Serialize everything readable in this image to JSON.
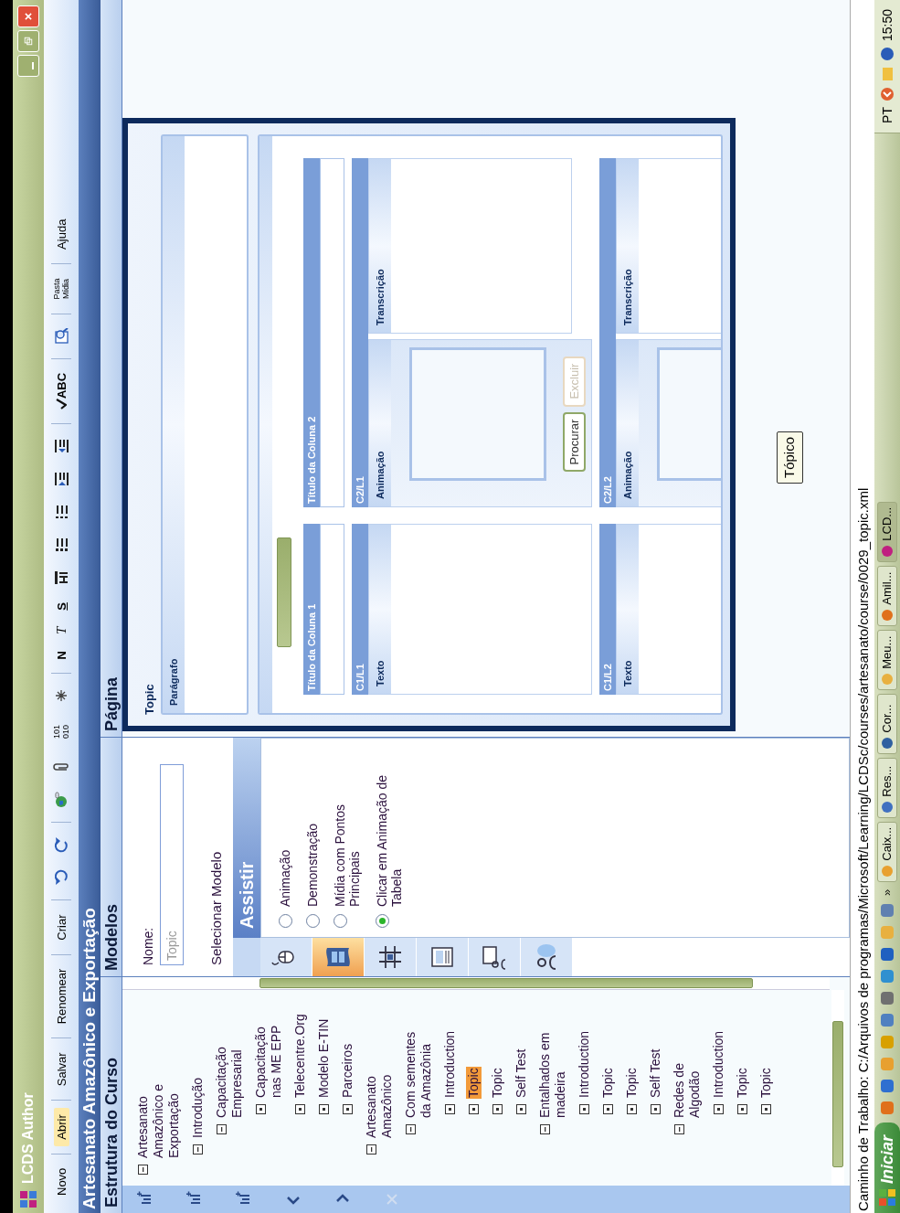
{
  "window": {
    "title": "LCDS Author"
  },
  "toolbar": [
    {
      "kind": "text",
      "label": "Novo",
      "highlighted": false,
      "sep": true
    },
    {
      "kind": "text",
      "label": "Abrir",
      "highlighted": true,
      "sep": true
    },
    {
      "kind": "text",
      "label": "Salvar",
      "highlighted": false,
      "sep": true
    },
    {
      "kind": "text",
      "label": "Renomear",
      "highlighted": false,
      "sep": true
    },
    {
      "kind": "text",
      "label": "Criar",
      "highlighted": false,
      "sep": true
    },
    {
      "kind": "undo",
      "highlighted": false,
      "sep": false
    },
    {
      "kind": "redo",
      "highlighted": false,
      "sep": true
    },
    {
      "kind": "globe",
      "highlighted": false,
      "sep": false
    },
    {
      "kind": "clip",
      "highlighted": false,
      "sep": false
    },
    {
      "kind": "small",
      "label": "101 010",
      "highlighted": false,
      "sep": false
    },
    {
      "kind": "asterisk",
      "highlighted": false,
      "sep": true
    },
    {
      "kind": "bold",
      "label": "N",
      "highlighted": false,
      "sep": false
    },
    {
      "kind": "italic",
      "label": "T",
      "highlighted": false,
      "sep": false
    },
    {
      "kind": "underline",
      "label": "S",
      "highlighted": false,
      "sep": false
    },
    {
      "kind": "heading",
      "highlighted": false,
      "sep": false
    },
    {
      "kind": "bullets",
      "highlighted": false,
      "sep": false
    },
    {
      "kind": "numbers",
      "highlighted": false,
      "sep": false
    },
    {
      "kind": "indent",
      "highlighted": false,
      "sep": false
    },
    {
      "kind": "outdent",
      "highlighted": false,
      "sep": true
    },
    {
      "kind": "spell",
      "label": "ABC",
      "highlighted": false,
      "sep": true
    },
    {
      "kind": "preview",
      "highlighted": false,
      "sep": true
    },
    {
      "kind": "small",
      "label": "Pasta Mídia",
      "highlighted": false,
      "sep": true
    },
    {
      "kind": "text",
      "label": "Ajuda",
      "highlighted": false,
      "sep": false
    }
  ],
  "course_title": "Artesanato Amazônico e Exportação",
  "course_tree": {
    "title": "Estrutura do Curso",
    "tools": [
      {
        "kind": "add",
        "disabled": false
      },
      {
        "kind": "add",
        "disabled": false
      },
      {
        "kind": "add",
        "disabled": false
      },
      {
        "kind": "prev",
        "disabled": false
      },
      {
        "kind": "next",
        "disabled": false
      },
      {
        "kind": "delete",
        "disabled": true
      }
    ],
    "items": [
      {
        "label": "Artesanato Amazônico e Exportação",
        "expanded": true,
        "selected": false,
        "children": [
          {
            "label": "Introdução",
            "expanded": true,
            "selected": false,
            "children": [
              {
                "label": "Capacitação Empresarial",
                "expanded": true,
                "selected": false,
                "children": [
                  {
                    "label": "Capacitação nas ME EPP",
                    "expanded": false,
                    "selected": false
                  },
                  {
                    "label": "Telecentre.Org",
                    "expanded": false,
                    "selected": false
                  },
                  {
                    "label": "Modelo E-TIN",
                    "expanded": false,
                    "selected": false
                  },
                  {
                    "label": "Parceiros",
                    "expanded": false,
                    "selected": false
                  }
                ]
              }
            ]
          },
          {
            "label": "Artesanato Amazônico",
            "expanded": true,
            "selected": false,
            "children": [
              {
                "label": "Com sementes da Amazônia",
                "expanded": true,
                "selected": false,
                "children": [
                  {
                    "label": "Introduction",
                    "expanded": false,
                    "selected": false
                  },
                  {
                    "label": "Topic",
                    "expanded": false,
                    "selected": true
                  },
                  {
                    "label": "Topic",
                    "expanded": false,
                    "selected": false
                  },
                  {
                    "label": "Self Test",
                    "expanded": false,
                    "selected": false
                  }
                ]
              },
              {
                "label": "Entalhados em madeira",
                "expanded": true,
                "selected": false,
                "children": [
                  {
                    "label": "Introduction",
                    "expanded": false,
                    "selected": false
                  },
                  {
                    "label": "Topic",
                    "expanded": false,
                    "selected": false
                  },
                  {
                    "label": "Topic",
                    "expanded": false,
                    "selected": false
                  },
                  {
                    "label": "Self Test",
                    "expanded": false,
                    "selected": false
                  }
                ]
              },
              {
                "label": "Redes de Algodão",
                "expanded": true,
                "selected": false,
                "children": [
                  {
                    "label": "Introduction",
                    "expanded": false,
                    "selected": false
                  },
                  {
                    "label": "Topic",
                    "expanded": false,
                    "selected": false
                  },
                  {
                    "label": "Topic",
                    "expanded": false,
                    "selected": false
                  }
                ]
              }
            ]
          }
        ]
      }
    ]
  },
  "templates": {
    "title": "Modelos",
    "name_label": "Nome:",
    "name_value": "Topic",
    "select_label": "Selecionar Modelo",
    "categories": [
      {
        "kind": "mouse",
        "selected": false
      },
      {
        "kind": "film",
        "selected": true
      },
      {
        "kind": "grid",
        "selected": false
      },
      {
        "kind": "document",
        "selected": false
      },
      {
        "kind": "screen",
        "selected": false
      },
      {
        "kind": "people",
        "selected": false
      }
    ],
    "group_title": "Assistir",
    "options": [
      {
        "label": "Animação",
        "selected": false
      },
      {
        "label": "Demonstração",
        "selected": false
      },
      {
        "label": "Mídia com Pontos Principais",
        "selected": false
      },
      {
        "label": "Clicar em Animação de Tabela",
        "selected": true
      }
    ]
  },
  "page": {
    "title": "Página",
    "preview_title": "Topic",
    "paragraph_label": "Parágrafo",
    "column_titles": [
      "Título da Coluna 1",
      "Título da Coluna 2"
    ],
    "layout_lines": [
      {
        "slots": [
          {
            "tag": "C1/L1",
            "kind": "text",
            "label": "Texto"
          },
          {
            "tag": "C2/L1",
            "kind": "media",
            "label": "Animação",
            "transcript_label": "Transcrição",
            "buttons": [
              {
                "label": "Procurar",
                "disabled": false
              },
              {
                "label": "Excluir",
                "disabled": true
              }
            ]
          }
        ]
      },
      {
        "slots": [
          {
            "tag": "C1/L2",
            "kind": "text",
            "label": "Texto"
          },
          {
            "tag": "C2/L2",
            "kind": "media",
            "label": "Animação",
            "transcript_label": "Transcrição"
          }
        ]
      }
    ],
    "topic_button": "Tópico"
  },
  "status_bar": "Caminho de Trabalho: C:/Arquivos de programas/Microsoft/Learning/LCDSc/courses/artesanato/course/0029_topic.xml",
  "taskbar": {
    "start": "Iniciar",
    "quick_launch": [
      {
        "color": "#e0701c"
      },
      {
        "color": "#2f6fd0"
      },
      {
        "color": "#e8a030"
      },
      {
        "color": "#d8a000"
      },
      {
        "color": "#5080c0"
      },
      {
        "color": "#707070"
      },
      {
        "color": "#3090d0"
      },
      {
        "color": "#2060c0"
      },
      {
        "color": "#e8b040"
      },
      {
        "color": "#6080b0"
      }
    ],
    "more": "»",
    "tasks": [
      {
        "label": "Caix...",
        "color": "#e8a030",
        "active": false
      },
      {
        "label": "Res...",
        "color": "#4070c0",
        "active": false
      },
      {
        "label": "Cor...",
        "color": "#3060a0",
        "active": false
      },
      {
        "label": "Meu...",
        "color": "#e8b040",
        "active": false
      },
      {
        "label": "Amil...",
        "color": "#e0701c",
        "active": false
      },
      {
        "label": "LCD...",
        "color": "#c02080",
        "active": true
      }
    ],
    "language": "PT",
    "clock": "15:50"
  }
}
